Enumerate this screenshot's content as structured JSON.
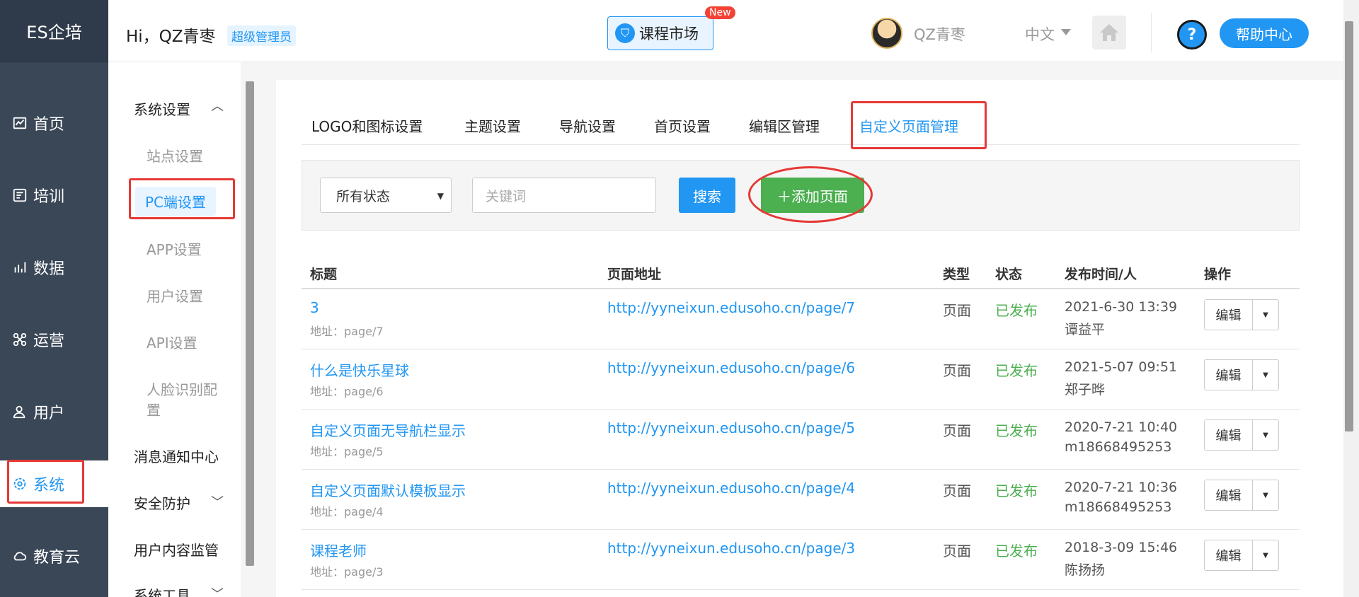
{
  "brand": "ES企培",
  "sidebar": {
    "items": [
      {
        "label": "首页",
        "icon": "chart-icon"
      },
      {
        "label": "培训",
        "icon": "training-icon"
      },
      {
        "label": "数据",
        "icon": "data-icon"
      },
      {
        "label": "运营",
        "icon": "operation-icon"
      },
      {
        "label": "用户",
        "icon": "user-icon"
      },
      {
        "label": "系统",
        "icon": "gear-icon",
        "active": true
      },
      {
        "label": "教育云",
        "icon": "cloud-icon"
      }
    ]
  },
  "header": {
    "greeting": "Hi，QZ青枣",
    "role": "超级管理员",
    "market": "课程市场",
    "new_badge": "New",
    "username": "QZ青枣",
    "language": "中文",
    "help": "帮助中心",
    "help_q": "?",
    "collapse": "«"
  },
  "submenu": {
    "system_settings": "系统设置",
    "items": [
      "站点设置",
      "PC端设置",
      "APP设置",
      "用户设置",
      "API设置",
      "人脸识别配",
      "置"
    ],
    "notify": "消息通知中心",
    "security": "安全防护",
    "content_monitor": "用户内容监管",
    "tools": "系统工具"
  },
  "tabs": [
    "LOGO和图标设置",
    "主题设置",
    "导航设置",
    "首页设置",
    "编辑区管理",
    "自定义页面管理"
  ],
  "toolbar": {
    "status_select": "所有状态",
    "keyword_placeholder": "关键词",
    "search": "搜索",
    "add": "＋添加页面"
  },
  "table": {
    "headers": [
      "标题",
      "页面地址",
      "类型",
      "状态",
      "发布时间/人",
      "操作"
    ],
    "rows": [
      {
        "title": "3",
        "addr": "地址：page/7",
        "url": "http://yyneixun.edusoho.cn/page/7",
        "type": "页面",
        "status": "已发布",
        "time": "2021-6-30 13:39",
        "user": "谭益平",
        "edit": "编辑"
      },
      {
        "title": "什么是快乐星球",
        "addr": "地址：page/6",
        "url": "http://yyneixun.edusoho.cn/page/6",
        "type": "页面",
        "status": "已发布",
        "time": "2021-5-07 09:51",
        "user": "郑子晔",
        "edit": "编辑"
      },
      {
        "title": "自定义页面无导航栏显示",
        "addr": "地址：page/5",
        "url": "http://yyneixun.edusoho.cn/page/5",
        "type": "页面",
        "status": "已发布",
        "time": "2020-7-21 10:40",
        "user": "m18668495253",
        "edit": "编辑"
      },
      {
        "title": "自定义页面默认模板显示",
        "addr": "地址：page/4",
        "url": "http://yyneixun.edusoho.cn/page/4",
        "type": "页面",
        "status": "已发布",
        "time": "2020-7-21 10:36",
        "user": "m18668495253",
        "edit": "编辑"
      },
      {
        "title": "课程老师",
        "addr": "地址：page/3",
        "url": "http://yyneixun.edusoho.cn/page/3",
        "type": "页面",
        "status": "已发布",
        "time": "2018-3-09 15:46",
        "user": "陈扬扬",
        "edit": "编辑"
      }
    ]
  },
  "colors": {
    "accent": "#2196f3",
    "success": "#4caf50",
    "sidebar": "#3a4757",
    "annotation": "#e53935"
  }
}
